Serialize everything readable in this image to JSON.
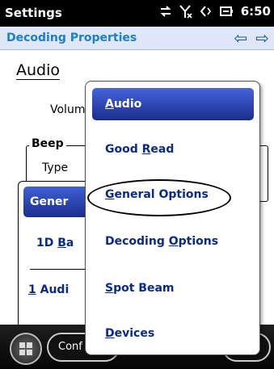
{
  "status_bar": {
    "title": "Settings",
    "icons": [
      "sync-icon",
      "antenna-off-icon",
      "speaker-icon",
      "battery-charging-icon"
    ],
    "time": "6:50"
  },
  "header": {
    "title": "Decoding Properties",
    "back_arrow": "⇦",
    "forward_arrow": "⇨"
  },
  "page": {
    "heading": "Audio",
    "volume_label": "Volum",
    "beep_legend": "Beep",
    "type_label": "Type",
    "tabs": {
      "general": "Gener",
      "bar_prefix": "1D ",
      "bar_ul": "B",
      "bar_suffix": "a",
      "audio_prefix": "",
      "audio_ul": "1",
      "audio_suffix": " Audi"
    }
  },
  "taskbar": {
    "confirm_label": "Conf"
  },
  "menu": {
    "items": [
      {
        "label_pre": "",
        "label_ul": "A",
        "label_post": "udio",
        "selected": true
      },
      {
        "label_pre": "Good ",
        "label_ul": "R",
        "label_post": "ead",
        "selected": false
      },
      {
        "label_pre": "",
        "label_ul": "G",
        "label_post": "eneral Options",
        "selected": false
      },
      {
        "label_pre": "Decoding ",
        "label_ul": "O",
        "label_post": "ptions",
        "selected": false
      },
      {
        "label_pre": "",
        "label_ul": "S",
        "label_post": "pot Beam",
        "selected": false
      },
      {
        "label_pre": "",
        "label_ul": "D",
        "label_post": "evices",
        "selected": false
      }
    ]
  }
}
